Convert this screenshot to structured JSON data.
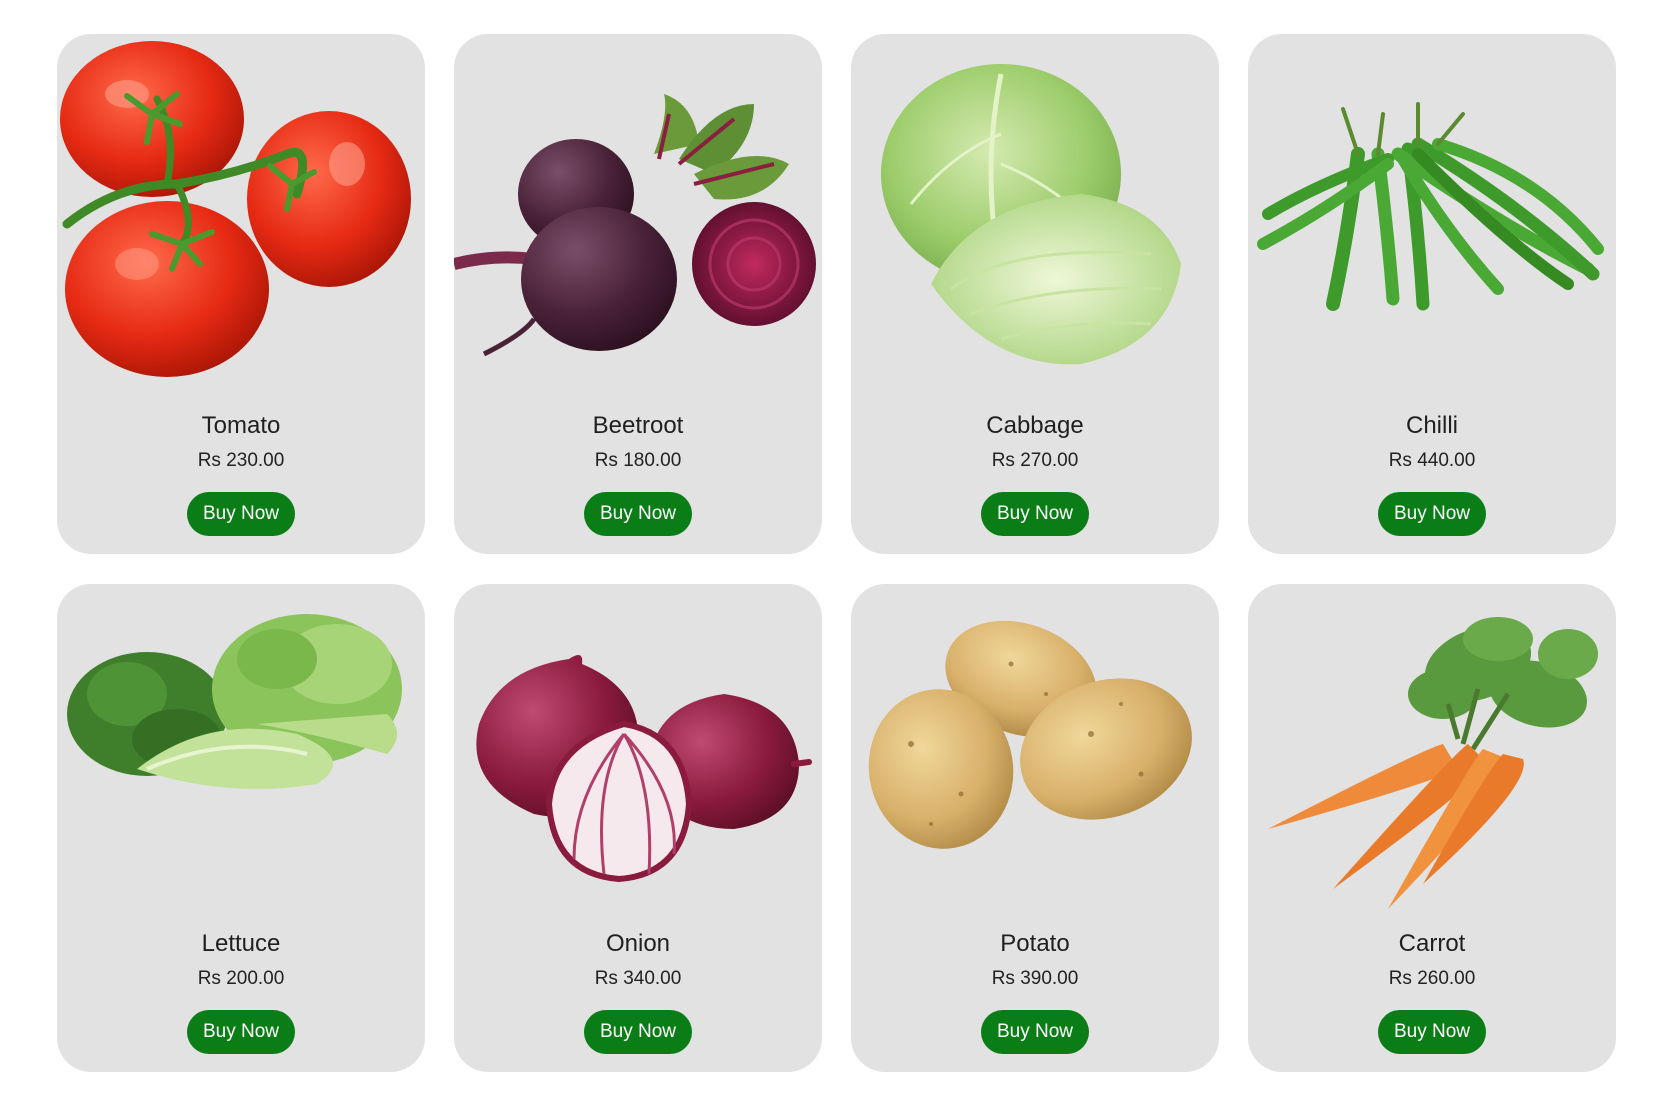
{
  "products": [
    {
      "name": "Tomato",
      "price": "Rs 230.00",
      "button": "Buy Now",
      "icon": "tomato-icon"
    },
    {
      "name": "Beetroot",
      "price": "Rs 180.00",
      "button": "Buy Now",
      "icon": "beetroot-icon"
    },
    {
      "name": "Cabbage",
      "price": "Rs 270.00",
      "button": "Buy Now",
      "icon": "cabbage-icon"
    },
    {
      "name": "Chilli",
      "price": "Rs 440.00",
      "button": "Buy Now",
      "icon": "chilli-icon"
    },
    {
      "name": "Lettuce",
      "price": "Rs 200.00",
      "button": "Buy Now",
      "icon": "lettuce-icon"
    },
    {
      "name": "Onion",
      "price": "Rs 340.00",
      "button": "Buy Now",
      "icon": "onion-icon"
    },
    {
      "name": "Potato",
      "price": "Rs 390.00",
      "button": "Buy Now",
      "icon": "potato-icon"
    },
    {
      "name": "Carrot",
      "price": "Rs 260.00",
      "button": "Buy Now",
      "icon": "carrot-icon"
    }
  ],
  "colors": {
    "card_background": "#e2e2e2",
    "button_background": "#0a7d16",
    "button_text": "#ffffff"
  }
}
